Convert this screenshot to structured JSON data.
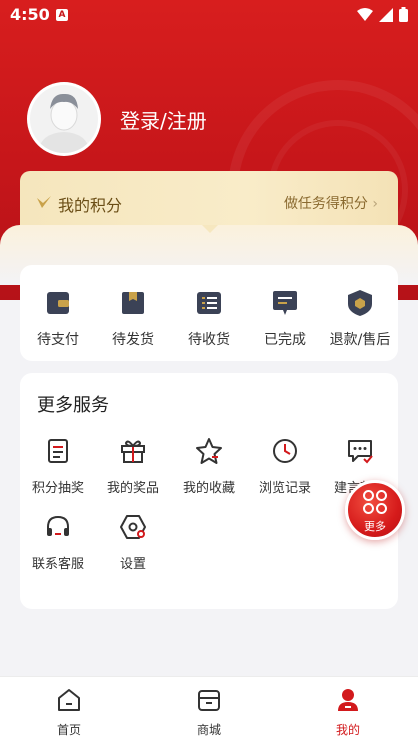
{
  "status": {
    "time": "4:50",
    "a_badge": "A"
  },
  "profile": {
    "login_label": "登录/注册"
  },
  "points": {
    "title": "我的积分",
    "task_link": "做任务得积分"
  },
  "orders": [
    {
      "label": "待支付",
      "icon": "wallet-icon"
    },
    {
      "label": "待发货",
      "icon": "package-icon"
    },
    {
      "label": "待收货",
      "icon": "list-box-icon"
    },
    {
      "label": "已完成",
      "icon": "chat-done-icon"
    },
    {
      "label": "退款/售后",
      "icon": "shield-icon"
    }
  ],
  "services": {
    "title": "更多服务",
    "items": [
      {
        "label": "积分抽奖",
        "icon": "document-icon"
      },
      {
        "label": "我的奖品",
        "icon": "gift-icon"
      },
      {
        "label": "我的收藏",
        "icon": "star-icon"
      },
      {
        "label": "浏览记录",
        "icon": "clock-icon"
      },
      {
        "label": "建言献策",
        "icon": "message-icon"
      },
      {
        "label": "联系客服",
        "icon": "headset-icon"
      },
      {
        "label": "设置",
        "icon": "settings-icon"
      }
    ]
  },
  "fab": {
    "label": "更多"
  },
  "tabs": [
    {
      "label": "首页"
    },
    {
      "label": "商城"
    },
    {
      "label": "我的"
    }
  ],
  "colors": {
    "brand": "#d2191c",
    "gold": "#f5e6bd",
    "icon_dark": "#3b4256"
  }
}
